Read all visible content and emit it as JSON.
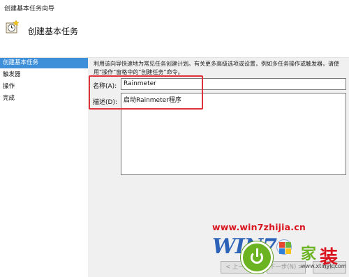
{
  "window": {
    "title": "创建基本任务向导"
  },
  "header": {
    "icon": "task-wizard-icon",
    "heading": "创建基本任务"
  },
  "sidebar": {
    "items": [
      {
        "label": "创建基本任务",
        "active": true
      },
      {
        "label": "触发器",
        "active": false
      },
      {
        "label": "操作",
        "active": false
      },
      {
        "label": "完成",
        "active": false
      }
    ]
  },
  "main": {
    "description": "利用该向导快速地为常见任务创建计划。有关更多高级选项或设置，例如多任务操作或触发器，请使用“操作”窗格中的“创建任务”命令。",
    "name_label": "名称(A):",
    "name_value": "Rainmeter",
    "desc_label": "描述(D):",
    "desc_value": "启动Rainmeter程序"
  },
  "buttons": {
    "back": "< 上一步(B)",
    "next": "下一步(N) >",
    "cancel": "取消"
  },
  "watermark": {
    "url": "www.win7zhijia.cn",
    "logo_text": "WIN7",
    "brand_char_1": "家",
    "brand_char_2": "装",
    "brand_url": "www.xtinyk.com"
  },
  "colors": {
    "highlight": "#e0303a",
    "sidebar_active": "#3c8fd8",
    "watermark_red": "#d9141e",
    "win7_blue": "#2c63b8",
    "badge_green": "#6bb320"
  }
}
